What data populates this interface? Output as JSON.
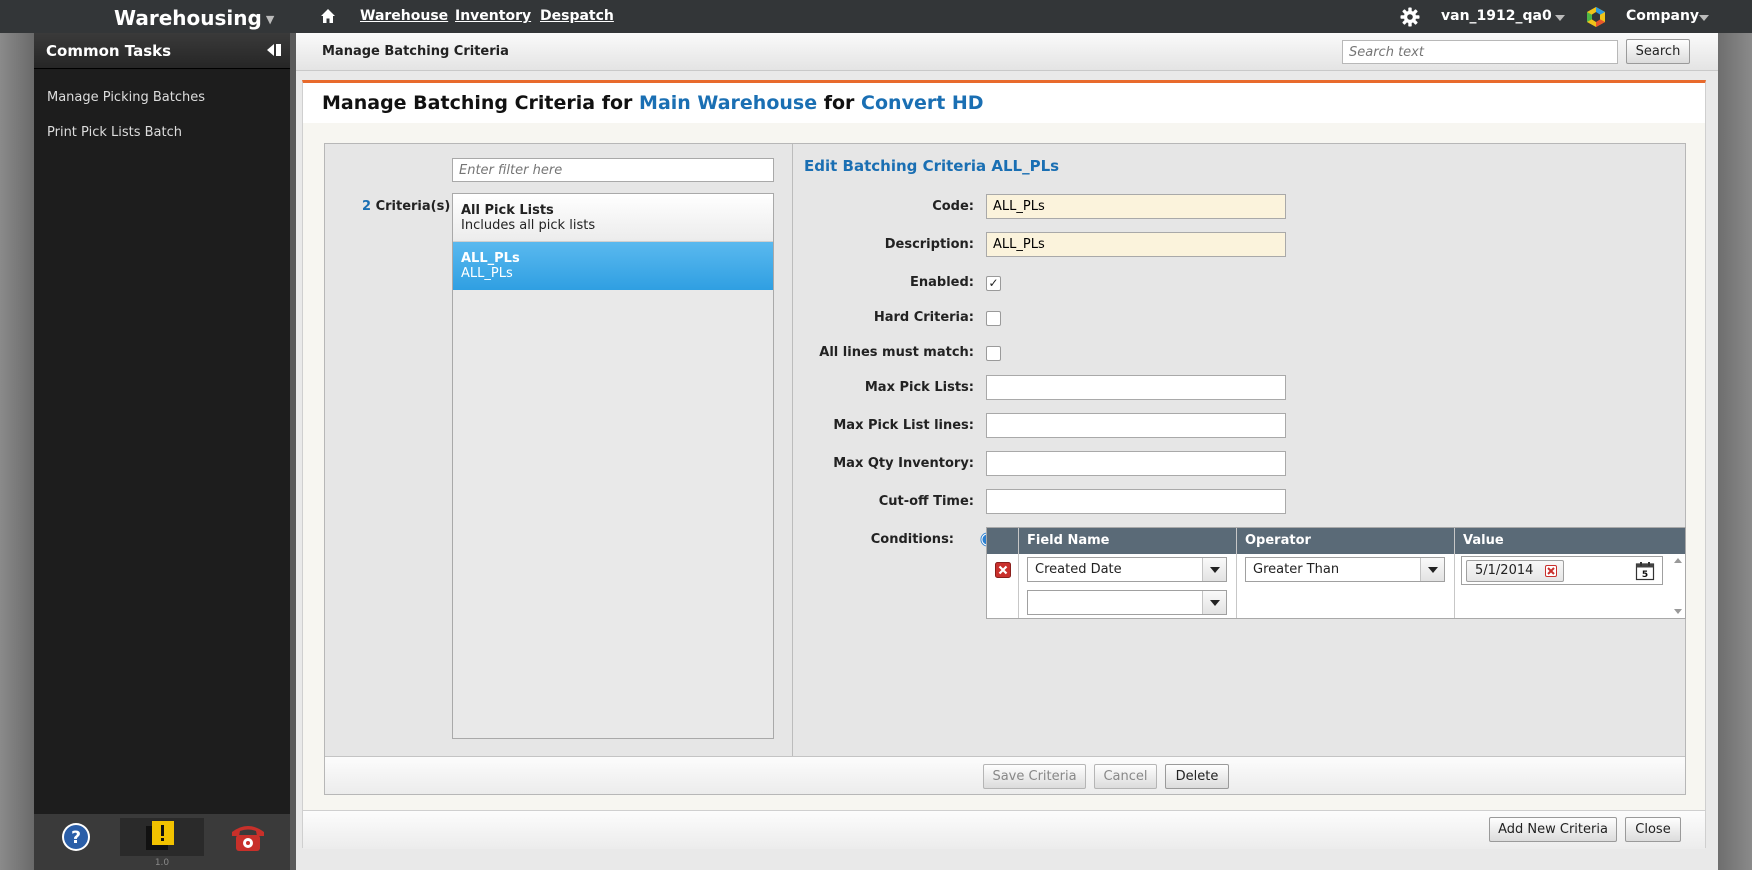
{
  "topbar": {
    "app_title": "Warehousing",
    "nav": [
      {
        "label": "Warehouse"
      },
      {
        "label": "Inventory"
      },
      {
        "label": "Despatch"
      }
    ],
    "user": "van_1912_qa0",
    "company": "Company"
  },
  "sidebar": {
    "title": "Common Tasks",
    "items": [
      {
        "label": "Manage Picking Batches"
      },
      {
        "label": "Print Pick Lists Batch"
      }
    ],
    "version": "1.0"
  },
  "header": {
    "breadcrumb": "Manage Batching Criteria",
    "search_placeholder": "Search text",
    "search_button": "Search"
  },
  "panel": {
    "title_prefix": "Manage Batching Criteria for",
    "warehouse": "Main Warehouse",
    "title_mid": "for",
    "company": "Convert HD"
  },
  "list": {
    "filter_placeholder": "Enter filter here",
    "count": "2",
    "count_suffix": "Criteria(s)",
    "items": [
      {
        "title": "All Pick Lists",
        "subtitle": "Includes all pick lists"
      },
      {
        "title": "ALL_PLs",
        "subtitle": "ALL_PLs"
      }
    ]
  },
  "form": {
    "title": "Edit Batching Criteria ALL_PLs",
    "code_label": "Code:",
    "code_value": "ALL_PLs",
    "description_label": "Description:",
    "description_value": "ALL_PLs",
    "enabled_label": "Enabled:",
    "enabled_mark": "✓",
    "hard_label": "Hard Criteria:",
    "all_lines_label": "All lines must match:",
    "max_pick_lists_label": "Max Pick Lists:",
    "max_pick_list_lines_label": "Max Pick List lines:",
    "max_qty_label": "Max Qty Inventory:",
    "cutoff_label": "Cut-off Time:",
    "conditions_label": "Conditions:",
    "conditions": {
      "headers": [
        "Field Name",
        "Operator",
        "Value"
      ],
      "row": {
        "field": "Created Date",
        "operator": "Greater Than",
        "value": "5/1/2014",
        "calendar_day": "5"
      }
    }
  },
  "actions": {
    "save": "Save Criteria",
    "cancel": "Cancel",
    "delete": "Delete",
    "add_new": "Add New Criteria",
    "close": "Close"
  },
  "colors": {
    "accent_blue": "#1a6fb3",
    "selected_row": "#3aa6e6",
    "panel_top_border": "#e86a2c",
    "required_field": "#fbf3dc"
  }
}
